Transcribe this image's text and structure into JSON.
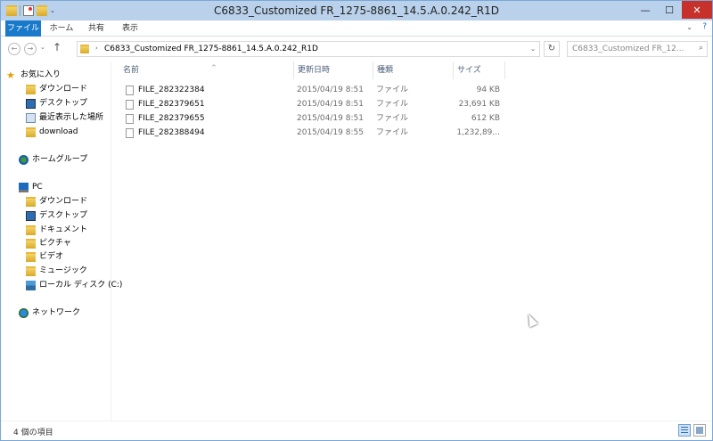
{
  "window": {
    "title": "C6833_Customized FR_1275-8861_14.5.A.0.242_R1D",
    "controls": {
      "minimize": "—",
      "maximize": "☐",
      "close": "✕"
    }
  },
  "ribbon": {
    "tabs": [
      "ファイル",
      "ホーム",
      "共有",
      "表示"
    ],
    "active_tab": "ファイル",
    "accent_color": "#1979ca",
    "help": "?",
    "expand": "⌄"
  },
  "navbar": {
    "back": "←",
    "forward": "→",
    "history_dropdown": "⌄",
    "up": "↑",
    "address_path": "C6833_Customized FR_1275-8861_14.5.A.0.242_R1D",
    "address_chevron": "›",
    "address_dropdown": "⌄",
    "refresh": "↻",
    "search_placeholder": "C6833_Customized FR_12...",
    "search_icon": "⌕"
  },
  "nav_pane": {
    "favorites_label": "お気に入り",
    "favorites": [
      "ダウンロード",
      "デスクトップ",
      "最近表示した場所",
      "download"
    ],
    "homegroup_label": "ホームグループ",
    "pc_label": "PC",
    "pc_items": [
      "ダウンロード",
      "デスクトップ",
      "ドキュメント",
      "ピクチャ",
      "ビデオ",
      "ミュージック",
      "ローカル ディスク (C:)"
    ],
    "network_label": "ネットワーク"
  },
  "columns": {
    "name": "名前",
    "date": "更新日時",
    "type": "種類",
    "size": "サイズ",
    "sort_arrow": "^"
  },
  "files": [
    {
      "name": "FILE_282322384",
      "date": "2015/04/19 8:51",
      "type": "ファイル",
      "size": "94 KB"
    },
    {
      "name": "FILE_282379651",
      "date": "2015/04/19 8:51",
      "type": "ファイル",
      "size": "23,691 KB"
    },
    {
      "name": "FILE_282379655",
      "date": "2015/04/19 8:51",
      "type": "ファイル",
      "size": "612 KB"
    },
    {
      "name": "FILE_282388494",
      "date": "2015/04/19 8:55",
      "type": "ファイル",
      "size": "1,232,89..."
    }
  ],
  "status": {
    "item_count": "4 個の項目"
  }
}
